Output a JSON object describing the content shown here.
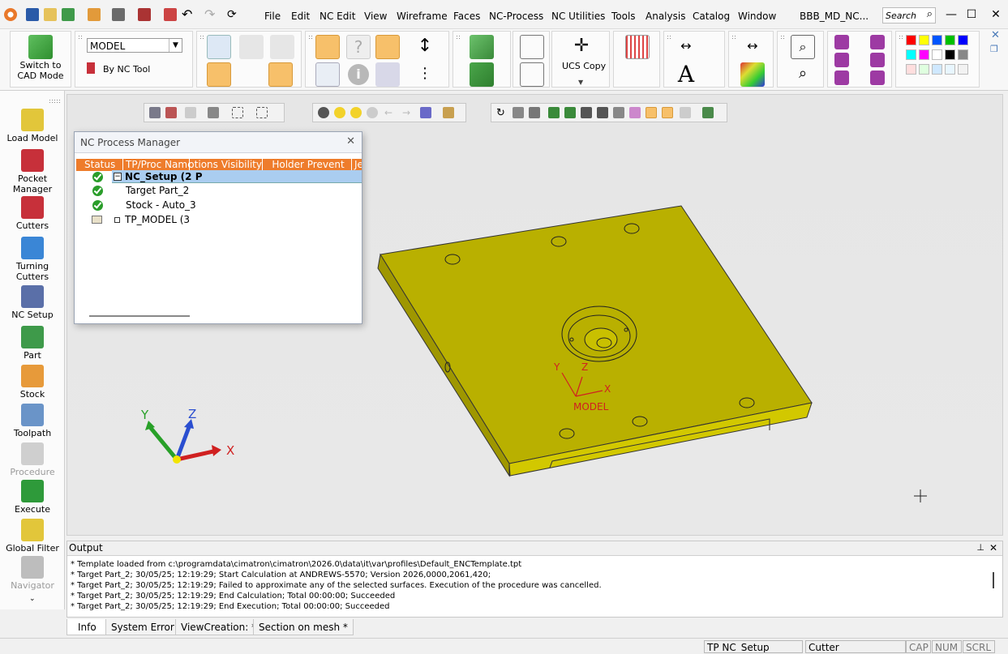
{
  "title": {
    "app_logo": "cimatron-logo-icon",
    "menus": [
      "File",
      "Edit",
      "NC Edit",
      "View",
      "Wireframe",
      "Faces",
      "NC-Process",
      "NC Utilities",
      "Tools",
      "Analysis",
      "Catalog",
      "Window"
    ],
    "document": "BBB_MD_NC...",
    "search_placeholder": "Search"
  },
  "ribbon": {
    "switch_label": "Switch to CAD Mode",
    "model_select": "MODEL",
    "by_nc_tool": "By NC Tool",
    "ucs_copy": "UCS Copy"
  },
  "left_toolbar": [
    {
      "label": "Load Model",
      "icon": "load-model-icon",
      "color": "#e2c63a",
      "enabled": true
    },
    {
      "label": "Pocket Manager",
      "icon": "pocket-manager-icon",
      "color": "#c7303a",
      "enabled": true
    },
    {
      "label": "Cutters",
      "icon": "cutters-icon",
      "color": "#c7303a",
      "enabled": true
    },
    {
      "label": "Turning Cutters",
      "icon": "turning-cutters-icon",
      "color": "#3a86d6",
      "enabled": true
    },
    {
      "label": "NC Setup",
      "icon": "nc-setup-icon",
      "color": "#5a6fa8",
      "enabled": true
    },
    {
      "label": "Part",
      "icon": "part-icon",
      "color": "#3e9a4a",
      "enabled": true
    },
    {
      "label": "Stock",
      "icon": "stock-icon",
      "color": "#e79a3a",
      "enabled": true
    },
    {
      "label": "Toolpath",
      "icon": "toolpath-icon",
      "color": "#6a94c8",
      "enabled": true
    },
    {
      "label": "Procedure",
      "icon": "procedure-icon",
      "color": "#cfcfcf",
      "enabled": false
    },
    {
      "label": "Execute",
      "icon": "execute-icon",
      "color": "#2e9a3a",
      "enabled": true
    },
    {
      "label": "Global Filter",
      "icon": "global-filter-icon",
      "color": "#e2c63a",
      "enabled": true
    },
    {
      "label": "Navigator",
      "icon": "navigator-icon",
      "color": "#bdbdbd",
      "enabled": false
    }
  ],
  "nc_process_manager": {
    "title": "NC Process Manager",
    "columns": [
      "Status",
      "TP/Proc Name",
      "Motions Visibility",
      "Holder Prevent",
      "Je"
    ],
    "rows": [
      {
        "name": "NC_Setup (2 P",
        "status": "ok",
        "selected": true
      },
      {
        "name": "Target Part_2",
        "status": "ok",
        "selected": false
      },
      {
        "name": "Stock - Auto_3",
        "status": "ok",
        "selected": false
      },
      {
        "name": "TP_MODEL (3",
        "status": "folder",
        "selected": false
      }
    ]
  },
  "viewport": {
    "model_label": "MODEL",
    "axes": {
      "x": "X",
      "y": "Y",
      "z": "Z"
    }
  },
  "output": {
    "title": "Output",
    "lines": [
      "* Template loaded from c:\\programdata\\cimatron\\cimatron\\2026.0\\data\\it\\var\\profiles\\Default_ENCTemplate.tpt",
      "* Target Part_2; 30/05/25; 12:19:29; Start Calculation at ANDREWS-5570; Version 2026,0000,2061,420;",
      "* Target Part_2; 30/05/25; 12:19:29; Failed to approximate any of the selected surfaces. Execution of the procedure was cancelled.",
      "* Target Part_2; 30/05/25; 12:19:29; End Calculation; Total 00:00:00; Succeeded",
      "* Target Part_2; 30/05/25; 12:19:29; End Execution; Total 00:00:00; Succeeded"
    ]
  },
  "tabs": [
    "Info",
    "System Error *",
    "ViewCreation: *",
    "Section on mesh *"
  ],
  "status": {
    "tp": "TP  NC_Setup",
    "mode": "Cutter",
    "cap": "CAP",
    "num": "NUM",
    "scrl": "SCRL"
  },
  "colors": {
    "accent": "#ee7c2b",
    "part": "#b9b000",
    "selection": "#aacdf0"
  }
}
